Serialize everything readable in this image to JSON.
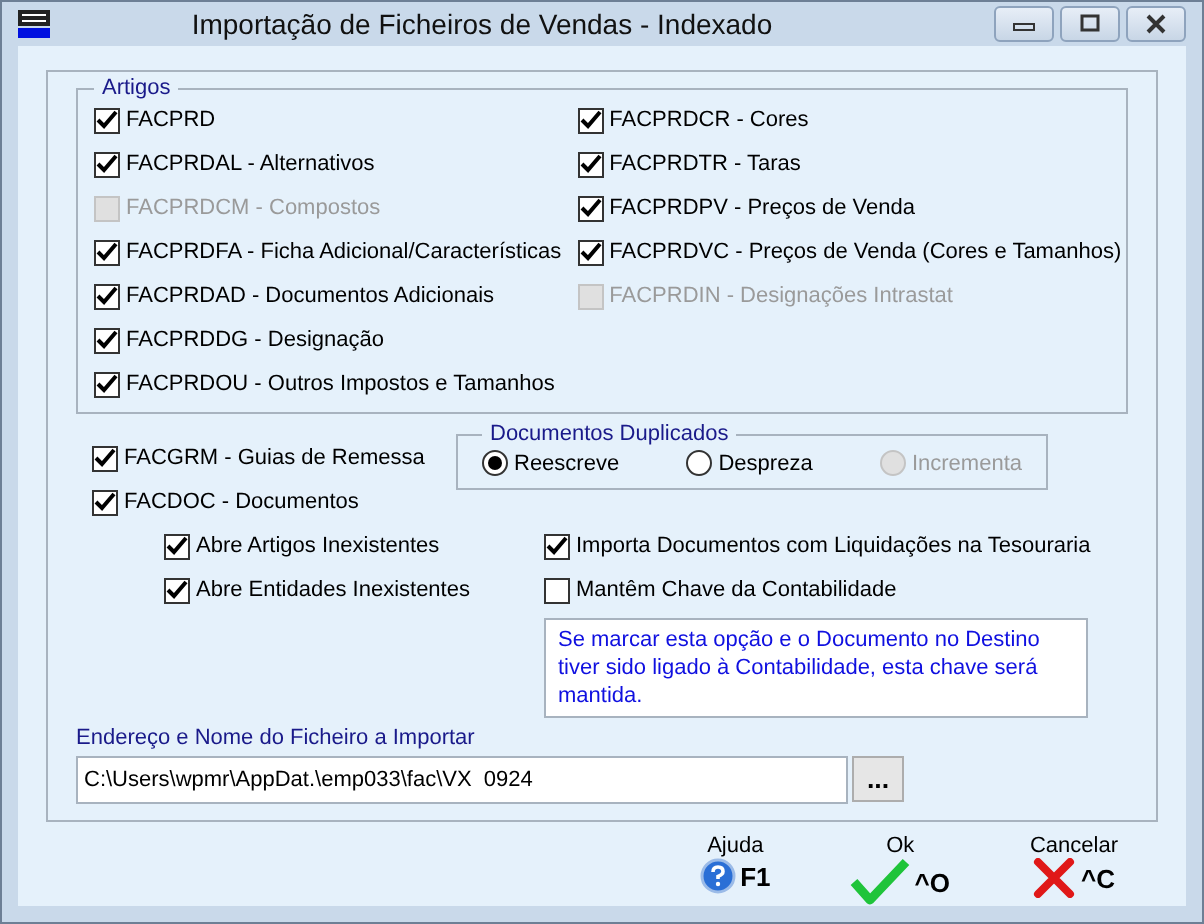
{
  "window": {
    "title": "Importação de Ficheiros de Vendas - Indexado"
  },
  "artigos": {
    "title": "Artigos",
    "columns": [
      [
        {
          "label": "FACPRD",
          "checked": true,
          "disabled": false
        },
        {
          "label": "FACPRDAL - Alternativos",
          "checked": true,
          "disabled": false
        },
        {
          "label": "FACPRDCM - Compostos",
          "checked": false,
          "disabled": true
        },
        {
          "label": "FACPRDFA - Ficha Adicional/Características",
          "checked": true,
          "disabled": false
        },
        {
          "label": "FACPRDAD - Documentos Adicionais",
          "checked": true,
          "disabled": false
        },
        {
          "label": "FACPRDDG - Designação",
          "checked": true,
          "disabled": false
        },
        {
          "label": "FACPRDOU - Outros Impostos e Tamanhos",
          "checked": true,
          "disabled": false
        }
      ],
      [
        {
          "label": "FACPRDCR - Cores",
          "checked": true,
          "disabled": false
        },
        {
          "label": "FACPRDTR - Taras",
          "checked": true,
          "disabled": false
        },
        {
          "label": "FACPRDPV - Preços de Venda",
          "checked": true,
          "disabled": false
        },
        {
          "label": "FACPRDVC - Preços de Venda (Cores e Tamanhos)",
          "checked": true,
          "disabled": false
        },
        {
          "label": "FACPRDIN - Designações Intrastat",
          "checked": false,
          "disabled": true
        }
      ]
    ]
  },
  "documentos": [
    {
      "label": "FACGRM - Guias de Remessa",
      "checked": true,
      "disabled": false
    },
    {
      "label": "FACDOC - Documentos",
      "checked": true,
      "disabled": false
    }
  ],
  "duplicados": {
    "title": "Documentos Duplicados",
    "options": [
      {
        "label": "Reescreve",
        "selected": true,
        "disabled": false
      },
      {
        "label": "Despreza",
        "selected": false,
        "disabled": false
      },
      {
        "label": "Incrementa",
        "selected": false,
        "disabled": true
      }
    ]
  },
  "options_left": [
    {
      "label": "Abre Artigos Inexistentes",
      "checked": true,
      "disabled": false
    },
    {
      "label": "Abre Entidades Inexistentes",
      "checked": true,
      "disabled": false
    }
  ],
  "options_right": [
    {
      "label": "Importa Documentos com Liquidações na Tesouraria",
      "checked": true,
      "disabled": false
    },
    {
      "label": "Mantêm Chave da Contabilidade",
      "checked": false,
      "disabled": false
    }
  ],
  "note": "Se marcar esta opção e o Documento no Destino tiver sido ligado à Contabilidade, esta chave será mantida.",
  "file": {
    "label": "Endereço e Nome do Ficheiro a Importar",
    "value": "C:\\Users\\wpmr\\AppDat.\\emp033\\fac\\VX  0924",
    "browse": "..."
  },
  "buttons": [
    {
      "kind": "help",
      "label": "Ajuda",
      "key": "F1"
    },
    {
      "kind": "ok",
      "label": "Ok",
      "key": "^O"
    },
    {
      "kind": "cancel",
      "label": "Cancelar",
      "key": "^C"
    }
  ]
}
